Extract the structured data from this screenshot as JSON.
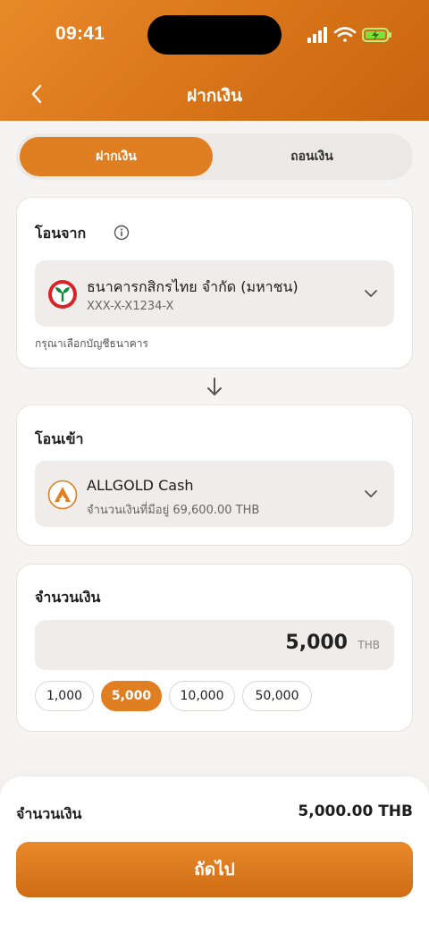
{
  "status_bar": {
    "time": "09:41"
  },
  "header": {
    "title": "ฝากเงิน"
  },
  "tabs": [
    {
      "label": "ฝากเงิน",
      "active": true
    },
    {
      "label": "ถอนเงิน",
      "active": false
    }
  ],
  "transfer_from": {
    "title": "โอนจาก",
    "account": {
      "name": "ธนาคารกสิกรไทย จำกัด (มหาชน)",
      "number": "XXX-X-X1234-X",
      "icon": "kbank-logo-icon"
    },
    "helper": "กรุณาเลือกบัญชีธนาคาร"
  },
  "transfer_to": {
    "title": "โอนเข้า",
    "account": {
      "name": "ALLGOLD Cash",
      "balance": "จำนวนเงินที่มีอยู่ 69,600.00 THB",
      "icon": "allgold-logo-icon"
    }
  },
  "amount": {
    "title": "จำนวนเงิน",
    "value": "5,000",
    "unit": "THB",
    "quick_amounts": [
      "1,000",
      "5,000",
      "10,000",
      "50,000"
    ],
    "selected": "5,000"
  },
  "summary": {
    "label": "จำนวนเงิน",
    "value": "5,000.00 THB"
  },
  "next_button": {
    "label": "ถัดไป"
  },
  "colors": {
    "accent": "#e07f22",
    "header": "#d77418",
    "background": "#f5f4f3"
  }
}
